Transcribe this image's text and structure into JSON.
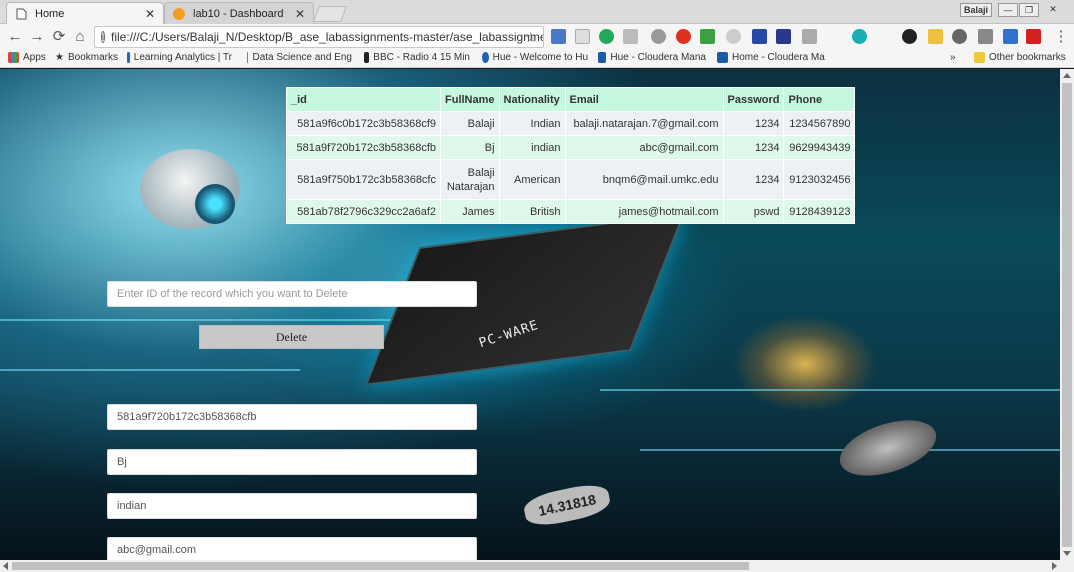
{
  "browser": {
    "tabs": [
      {
        "title": "Home",
        "icon": "page-icon"
      },
      {
        "title": "lab10 - Dashboard",
        "icon": "favicon-orange"
      }
    ],
    "window_user": "Balaji",
    "url": "file:///C:/Users/Balaji_N/Desktop/B_ase_labassignments-master/ase_labassignment:",
    "bookmarks": [
      {
        "label": "Apps",
        "icon": "apps-grid-icon"
      },
      {
        "label": "Bookmarks",
        "icon": "star-icon"
      },
      {
        "label": "Learning Analytics | Tr",
        "icon": "learning-icon"
      },
      {
        "label": "Data Science and Eng",
        "icon": "datascience-icon"
      },
      {
        "label": "BBC - Radio 4 15 Min",
        "icon": "bbc-icon"
      },
      {
        "label": "Hue - Welcome to Hu",
        "icon": "hue-icon"
      },
      {
        "label": "Hue - Cloudera Mana",
        "icon": "cloudera-icon"
      },
      {
        "label": "Home - Cloudera Ma",
        "icon": "cloudera-icon"
      }
    ],
    "bookmarks_overflow": "»",
    "other_bookmarks": "Other bookmarks"
  },
  "table": {
    "headers": [
      "_id",
      "FullName",
      "Nationality",
      "Email",
      "Password",
      "Phone"
    ],
    "rows": [
      [
        "581a9f6c0b172c3b58368cf9",
        "Balaji",
        "Indian",
        "balaji.natarajan.7@gmail.com",
        "1234",
        "1234567890"
      ],
      [
        "581a9f720b172c3b58368cfb",
        "Bj",
        "indian",
        "abc@gmail.com",
        "1234",
        "9629943439"
      ],
      [
        "581a9f750b172c3b58368cfc",
        "Balaji Natarajan",
        "American",
        "bnqm6@mail.umkc.edu",
        "1234",
        "9123032456"
      ],
      [
        "581ab78f2796c329cc2a6af2",
        "James",
        "British",
        "james@hotmail.com",
        "pswd",
        "9128439123"
      ]
    ]
  },
  "delete_form": {
    "placeholder": "Enter ID of the record which you want to Delete",
    "button_label": "Delete"
  },
  "edit_form": {
    "id_value": "581a9f720b172c3b58368cfb",
    "name_value": "Bj",
    "nationality_value": "indian",
    "email_value": "abc@gmail.com"
  },
  "background_art": {
    "chip_label": "PC-WARE",
    "capacitor_label": "14.31818"
  }
}
